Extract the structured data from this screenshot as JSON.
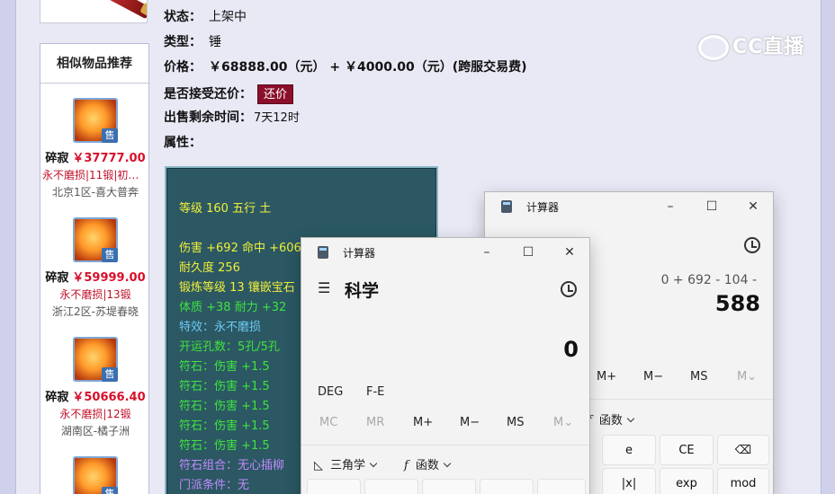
{
  "watermark": "CC直播",
  "similar": {
    "heading": "相似物品推荐",
    "sell_tag": "售",
    "items": [
      {
        "name": "碎寂",
        "price": "￥37777.00",
        "attrs": "永不磨损|11锻|初伤…",
        "server": "北京1区-喜大普奔"
      },
      {
        "name": "碎寂",
        "price": "￥59999.00",
        "attrs": "永不磨损|13锻",
        "server": "浙江2区-苏堤春晓"
      },
      {
        "name": "碎寂",
        "price": "￥50666.40",
        "attrs": "永不磨损|12锻",
        "server": "湖南区-橘子洲"
      }
    ]
  },
  "info": {
    "status_label": "状态：",
    "status_value": "上架中",
    "type_label": "类型：",
    "type_value": "锤",
    "price_label": "价格：",
    "price_value": "￥68888.00（元） +  ￥4000.00（元）(跨服交易费)",
    "counter_label": "是否接受还价：",
    "counter_button": "还价",
    "time_label": "出售剩余时间：",
    "time_value": "7天12时",
    "attr_label": "属性："
  },
  "attributes": {
    "line1": "等级 160 五行 土",
    "line2": "伤害 +692 命中 +606",
    "line3": "耐久度 256",
    "line4": "锻炼等级 13 镶嵌宝石",
    "line5": "体质 +38 耐力 +32",
    "line6": "特效：永不磨损",
    "line7": "开运孔数：5孔/5孔",
    "line8": "符石：伤害 +1.5",
    "line9": "符石：伤害 +1.5",
    "line10": "符石：伤害 +1.5",
    "line11": "符石：伤害 +1.5",
    "line12": "符石：伤害 +1.5",
    "line13": "符石组合：无心插柳",
    "line14": "门派条件：无"
  },
  "calc_back": {
    "title": "计算器",
    "mode": "科学",
    "expression": "0 + 692 - 104 -",
    "result": "588",
    "memory": [
      "M+",
      "M−",
      "MS",
      "M⌄"
    ],
    "func_dropdown": "函数",
    "keys": [
      "e",
      "CE",
      "⌫",
      "|x|",
      "exp",
      "mod"
    ]
  },
  "calc_front": {
    "title": "计算器",
    "mode": "科学",
    "result": "0",
    "angle_keys": [
      "DEG",
      "F-E"
    ],
    "memory": [
      "MC",
      "MR",
      "M+",
      "M−",
      "MS",
      "M⌄"
    ],
    "trig_dropdown": "三角学",
    "func_dropdown": "函数"
  },
  "colors": {
    "price_red": "#d8102a",
    "counter_bg": "#8b0f2b",
    "attr_bg": "#2b5863"
  }
}
